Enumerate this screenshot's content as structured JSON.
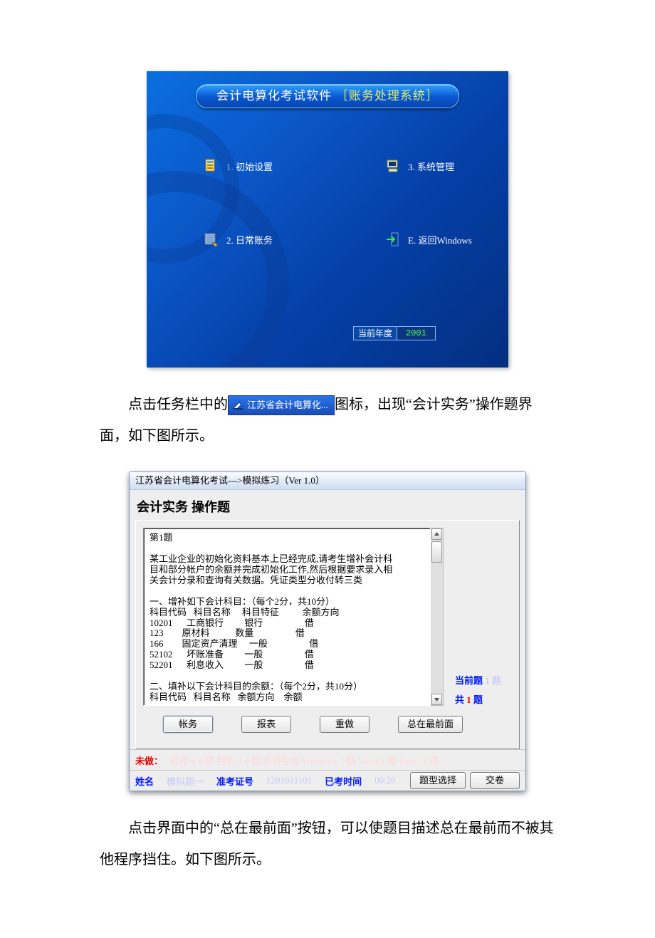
{
  "shot1": {
    "title_part1": "会计电算化考试软件",
    "title_part2": "［账务处理系统］",
    "menu": {
      "m1": "1. 初始设置",
      "m2": "2. 日常账务",
      "m3": "3. 系统管理",
      "m4": "E. 返回Windows"
    },
    "year_label": "当前年度",
    "year_value": "2001"
  },
  "para1_a": "点击任务栏中的",
  "taskbar_label": "江苏省会计电算化...",
  "para1_b": "图标，出现“会计实务”操作题界面，如下图所示。",
  "shot2": {
    "window_title": "江苏省会计电算化考试--->模拟练习（Ver 1.0）",
    "heading": "会计实务 操作题",
    "question_text": "第1题\n\n某工业企业的初始化资料基本上已经完成,请考生增补会计科\n目和部分帐户的余额并完成初始化工作,然后根据要求录入相\n关会计分录和查询有关数据。凭证类型分收付转三类\n\n一、增补如下会计科目：（每个2分，共10分）\n科目代码   科目名称     科目特征          余额方向\n10201      工商银行         银行                  借\n123        原材料           数量                  借\n166        固定资产清理     一般                  借\n52102      坏账准备         一般                  借\n52201      利息收入         一般                  借\n\n二、填补以下会计科目的余额：（每个2分，共10分）\n科目代码   科目名称   余额方向    余额",
    "side": {
      "current_label": "当前题",
      "current_num_faded": "1 题",
      "total_label": "共",
      "total_mid": "1",
      "total_suffix": "题"
    },
    "buttons": {
      "b1": "帐务",
      "b2": "报表",
      "b3": "重做",
      "b4": "总在最前面"
    },
    "status_top": {
      "label": "未做：",
      "faint": "选择 4 0 题   判断 2 0 题   实务全做   Windows 1 题   Word 1 题   Excel 1 题"
    },
    "status_bot": {
      "name_label": "姓名",
      "name_faint": "模拟题一",
      "id_label": "准考证号",
      "id_faint": "1201011101",
      "time_label": "已考时间",
      "time_faint": "00:20",
      "btn1": "题型选择",
      "btn2": "交卷"
    }
  },
  "para2": "点击界面中的“总在最前面”按钮，可以使题目描述总在最前而不被其他程序挡住。如下图所示。"
}
